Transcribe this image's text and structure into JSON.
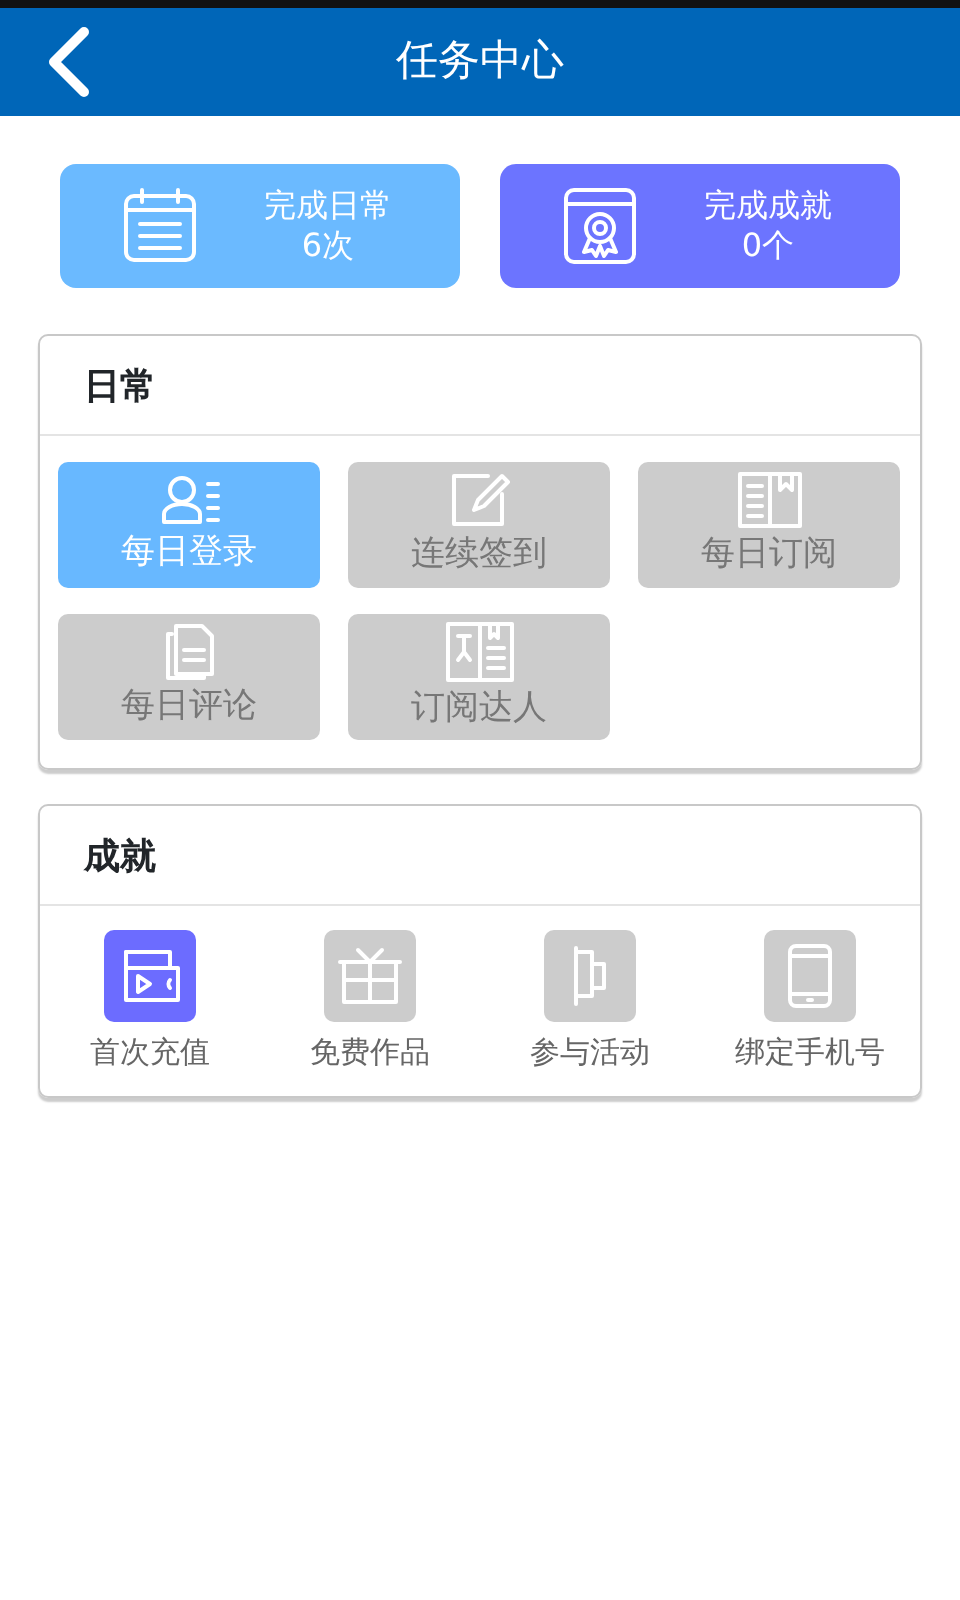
{
  "header": {
    "title": "任务中心"
  },
  "stats": [
    {
      "kind": "calendar",
      "label": "完成日常",
      "value": "6次"
    },
    {
      "kind": "certificate",
      "label": "完成成就",
      "value": "0个"
    }
  ],
  "daily": {
    "title": "日常",
    "tasks": [
      {
        "kind": "user",
        "label": "每日登录",
        "done": true
      },
      {
        "kind": "pencil",
        "label": "连续签到",
        "done": false
      },
      {
        "kind": "book",
        "label": "每日订阅",
        "done": false
      },
      {
        "kind": "docs",
        "label": "每日评论",
        "done": false
      },
      {
        "kind": "reader",
        "label": "订阅达人",
        "done": false
      }
    ]
  },
  "achievements": {
    "title": "成就",
    "items": [
      {
        "kind": "wallet",
        "label": "首次充值",
        "done": true
      },
      {
        "kind": "gift",
        "label": "免费作品",
        "done": false
      },
      {
        "kind": "flag",
        "label": "参与活动",
        "done": false
      },
      {
        "kind": "phone",
        "label": "绑定手机号",
        "done": false
      }
    ]
  }
}
